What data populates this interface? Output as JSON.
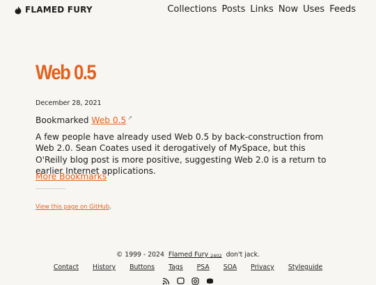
{
  "header": {
    "brand": "FLAMED FURY",
    "nav": [
      "Collections",
      "Posts",
      "Links",
      "Now",
      "Uses",
      "Feeds"
    ]
  },
  "post": {
    "title": "Web 0.5",
    "date": "December 28, 2021",
    "bookmarked_prefix": "Bookmarked",
    "bookmarked_link": "Web 0.5",
    "description": "A few people have already used Web 0.5 by back-construction from Web 2.0. Sean Coates used it derogatively of MySpace, but this O'Reilly blog post is more positive, suggesting Web 2.0 is a return to earlier Internet applications.",
    "more_link": "More Bookmarks",
    "github_link": "View this page on GitHub",
    "github_suffix": "."
  },
  "footer": {
    "copyright": "© 1999 - 2024",
    "brand_link": "Flamed Fury",
    "brand_sub": "2402",
    "tagline": "don't jack.",
    "links": [
      "Contact",
      "History",
      "Buttons",
      "Tags",
      "PSA",
      "SOA",
      "Privacy",
      "Styleguide"
    ],
    "social_icons": [
      "rss-icon",
      "mastodon-icon",
      "instagram-icon",
      "discord-icon"
    ]
  },
  "colors": {
    "accent": "#e2611d",
    "background": "#f7f6f3",
    "text": "#1d1d1d"
  }
}
